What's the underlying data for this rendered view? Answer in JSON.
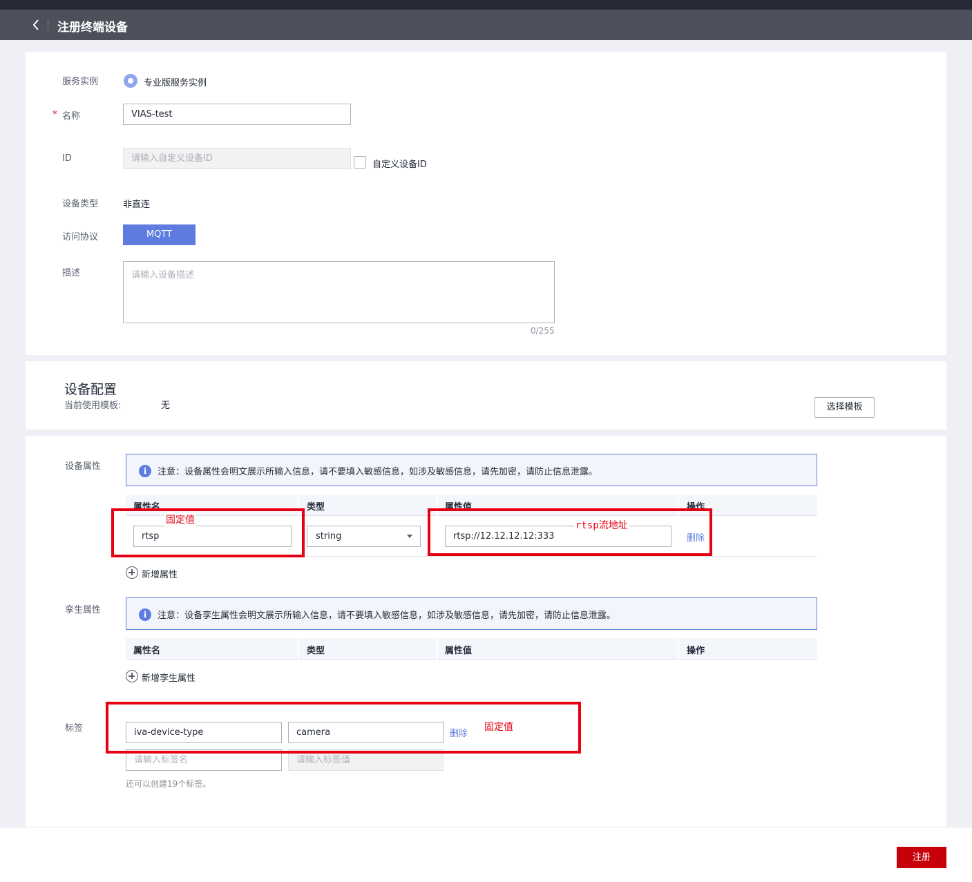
{
  "header": {
    "title": "注册终端设备"
  },
  "basic": {
    "service_instance_label": "服务实例",
    "service_instance_value": "专业版服务实例",
    "name_label": "名称",
    "required_mark": "*",
    "name_value": "VIAS-test",
    "id_label": "ID",
    "id_placeholder": "请输入自定义设备ID",
    "custom_id_checkbox_label": "自定义设备ID",
    "device_type_label": "设备类型",
    "device_type_value": "非直连",
    "protocol_label": "访问协议",
    "protocol_value": "MQTT",
    "desc_label": "描述",
    "desc_placeholder": "请输入设备描述",
    "desc_counter": "0/255"
  },
  "config": {
    "heading": "设备配置",
    "template_label": "当前使用模板:",
    "template_value": "无",
    "select_template_button": "选择模板"
  },
  "properties": {
    "label": "设备属性",
    "notice": "注意：设备属性会明文展示所输入信息，请不要填入敏感信息，如涉及敏感信息，请先加密，请防止信息泄露。",
    "columns": [
      "属性名",
      "类型",
      "属性值",
      "操作"
    ],
    "rows": [
      {
        "name": "rtsp",
        "type": "string",
        "value": "rtsp://12.12.12.12:333",
        "action": "删除"
      }
    ],
    "add_button": "新增属性"
  },
  "twin": {
    "label": "孪生属性",
    "notice": "注意：设备孪生属性会明文展示所输入信息，请不要填入敏感信息，如涉及敏感信息，请先加密，请防止信息泄露。",
    "columns": [
      "属性名",
      "类型",
      "属性值",
      "操作"
    ],
    "add_button": "新增孪生属性"
  },
  "tags": {
    "label": "标签",
    "rows": [
      {
        "key": "iva-device-type",
        "value": "camera",
        "action": "删除"
      }
    ],
    "key_placeholder": "请输入标签名",
    "value_placeholder": "请输入标签值",
    "hint": "还可以创建19个标签。"
  },
  "annotations": {
    "fixed_value_1": "固定值",
    "rtsp_address": "rtsp流地址",
    "fixed_value_2": "固定值",
    "color": "#e60012"
  },
  "footer": {
    "register_button": "注册"
  },
  "colors": {
    "primary_blue": "#5e7ce0",
    "register_red": "#c7000b",
    "header_bg": "#4b505b"
  }
}
